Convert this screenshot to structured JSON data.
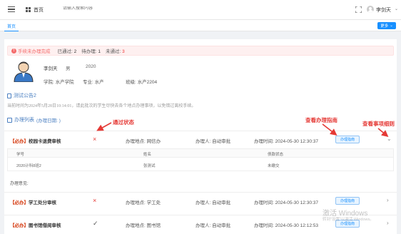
{
  "header": {
    "home_label": "首页",
    "search_placeholder": "请输入搜索内容",
    "user_name": "李剑天",
    "user_caret": "⌄"
  },
  "tabs": {
    "home_tab": "首页",
    "more_button": "更多",
    "more_caret": "⌄"
  },
  "alert": {
    "icon": "!",
    "title": "手续未办理完成",
    "passed_label": "已通过:",
    "passed_value": "2",
    "pending_label": "待办理:",
    "pending_value": "1",
    "failed_label": "未通过:",
    "failed_value": "3"
  },
  "student": {
    "name": "李剑天",
    "gender": "男",
    "year": "2020",
    "college": "学院: 水产学院",
    "major": "专业: 水产",
    "class": "班级: 水产2204"
  },
  "notice": {
    "title": "测试公告2",
    "body": "当前时间为2024年5月28日10:14:01，请此批次的学生尽快去各个地点办理事项，以免错过离校手续。"
  },
  "list": {
    "title": "办理列表",
    "subtitle": "(办理日期: )"
  },
  "rows": [
    {
      "tag": "【必办】",
      "name": "校园卡退费审核",
      "status": "×",
      "location": "办理地点: 网信办",
      "handler": "办理人: 自动审批",
      "time": "办理时间: 2024-05-30 12:30:37",
      "guide": "办理指南",
      "chevron": "⌄"
    },
    {
      "tag": "【必办】",
      "name": "学工处分审核",
      "status": "×",
      "location": "办理地点: 学工处",
      "handler": "办理人: 自动审批",
      "time": "办理时间: 2024-05-30 12:30:37",
      "guide": "办理指南",
      "chevron": "›"
    },
    {
      "tag": "【必办】",
      "name": "图书馆借阅审核",
      "status": "✓",
      "location": "办理地点: 图书馆",
      "handler": "办理人: 自动审批",
      "time": "办理时间: 2024-05-30 12:12:53",
      "guide": "办理指南",
      "chevron": "›"
    }
  ],
  "detail_table": {
    "headers": [
      "学号",
      "姓名",
      "债款状态"
    ],
    "cells": [
      "2020计科8班2",
      "张测试",
      "未缴交"
    ]
  },
  "opinion_label": "办理意见:",
  "annotations": {
    "status_note": "通过状态",
    "guide_note": "查看办理指南",
    "detail_note": "查看事项细则"
  },
  "watermark": {
    "line1": "激活 Windows",
    "line2": "转到\"设置\"以激活 Windows。"
  }
}
